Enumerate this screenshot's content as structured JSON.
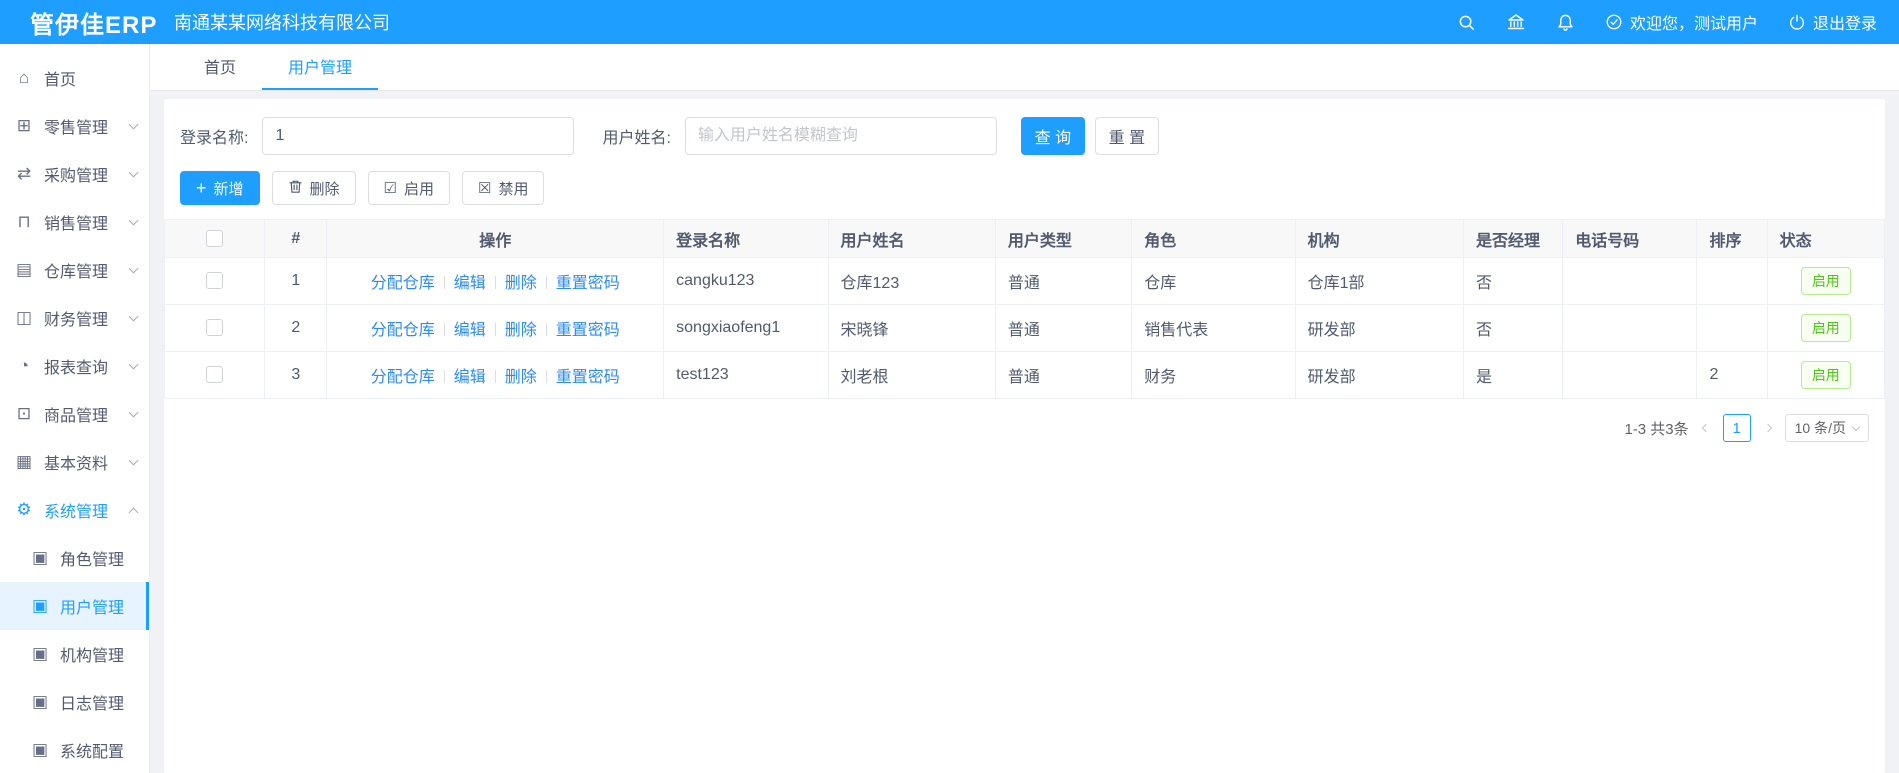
{
  "header": {
    "logo": "管伊佳ERP",
    "company": "南通某某网络科技有限公司",
    "welcome": "欢迎您，测试用户",
    "logout": "退出登录"
  },
  "sidebar": {
    "items": [
      {
        "label": "首页",
        "icon": "home-icon",
        "glyph": "⌂"
      },
      {
        "label": "零售管理",
        "icon": "retail-icon",
        "glyph": "⊞"
      },
      {
        "label": "采购管理",
        "icon": "purchase-icon",
        "glyph": "⇄"
      },
      {
        "label": "销售管理",
        "icon": "sales-cart-icon",
        "glyph": "⊓"
      },
      {
        "label": "仓库管理",
        "icon": "warehouse-icon",
        "glyph": "▤"
      },
      {
        "label": "财务管理",
        "icon": "finance-icon",
        "glyph": "◫"
      },
      {
        "label": "报表查询",
        "icon": "report-pie-icon",
        "glyph": "◔"
      },
      {
        "label": "商品管理",
        "icon": "goods-icon",
        "glyph": "⊡"
      },
      {
        "label": "基本资料",
        "icon": "basic-data-icon",
        "glyph": "▦"
      },
      {
        "label": "系统管理",
        "icon": "gear-icon",
        "glyph": "⚙"
      }
    ],
    "submenu": [
      {
        "label": "角色管理",
        "icon": "doc-icon",
        "glyph": "▣"
      },
      {
        "label": "用户管理",
        "icon": "doc-icon",
        "glyph": "▣"
      },
      {
        "label": "机构管理",
        "icon": "doc-icon",
        "glyph": "▣"
      },
      {
        "label": "日志管理",
        "icon": "doc-icon",
        "glyph": "▣"
      },
      {
        "label": "系统配置",
        "icon": "doc-icon",
        "glyph": "▣"
      }
    ]
  },
  "tabs": [
    {
      "label": "首页"
    },
    {
      "label": "用户管理"
    }
  ],
  "search": {
    "login_label": "登录名称:",
    "login_value": "1",
    "name_label": "用户姓名:",
    "name_placeholder": "输入用户姓名模糊查询",
    "query_label": "查 询",
    "reset_label": "重 置"
  },
  "toolbar": {
    "add_label": "新增",
    "delete_label": "删除",
    "enable_label": "启用",
    "disable_label": "禁用"
  },
  "icons": {
    "plus": "+",
    "enable_box": "☑",
    "disable_box": "☒"
  },
  "table": {
    "columns": [
      "#",
      "操作",
      "登录名称",
      "用户姓名",
      "用户类型",
      "角色",
      "机构",
      "是否经理",
      "电话号码",
      "排序",
      "状态"
    ],
    "op_links": [
      "分配仓库",
      "编辑",
      "删除",
      "重置密码"
    ],
    "rows": [
      {
        "index": "1",
        "login": "cangku123",
        "name": "仓库123",
        "type": "普通",
        "role": "仓库",
        "org": "仓库1部",
        "manager": "否",
        "phone": "",
        "sort": "",
        "status": "启用"
      },
      {
        "index": "2",
        "login": "songxiaofeng1",
        "name": "宋晓锋",
        "type": "普通",
        "role": "销售代表",
        "org": "研发部",
        "manager": "否",
        "phone": "",
        "sort": "",
        "status": "启用"
      },
      {
        "index": "3",
        "login": "test123",
        "name": "刘老根",
        "type": "普通",
        "role": "财务",
        "org": "研发部",
        "manager": "是",
        "phone": "",
        "sort": "2",
        "status": "启用"
      }
    ]
  },
  "pagination": {
    "total": "1-3 共3条",
    "page": "1",
    "page_size": "10 条/页"
  },
  "colors": {
    "topbar": "#1e9fff",
    "accent": "#1e9fff",
    "link": "#2d8cf0",
    "status_green": "#52c41a",
    "content_bg": "#f0f2f5"
  }
}
